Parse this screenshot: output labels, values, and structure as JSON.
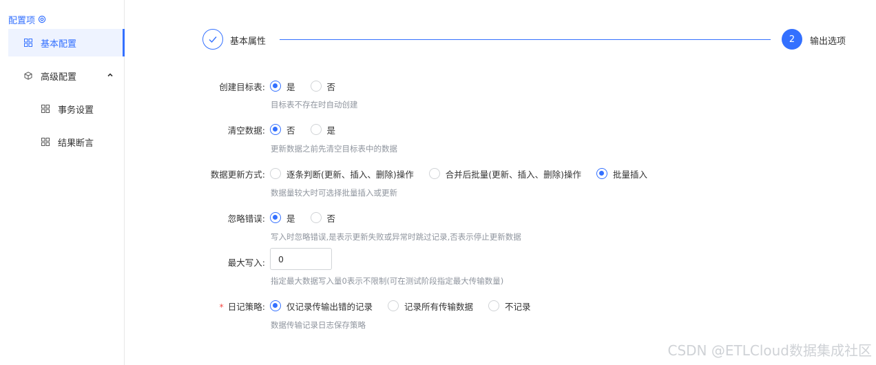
{
  "sidebar": {
    "title": "配置项",
    "items": [
      {
        "label": "基本配置"
      },
      {
        "label": "高级配置"
      },
      {
        "label": "事务设置"
      },
      {
        "label": "结果断言"
      }
    ]
  },
  "steps": [
    {
      "label": "基本属性",
      "state": "done"
    },
    {
      "number": "2",
      "label": "输出选项",
      "state": "current"
    }
  ],
  "form": {
    "create_table": {
      "label": "创建目标表:",
      "options": [
        "是",
        "否"
      ],
      "selected": "是",
      "hint": "目标表不存在时自动创建"
    },
    "clear_data": {
      "label": "清空数据:",
      "options": [
        "否",
        "是"
      ],
      "selected": "否",
      "hint": "更新数据之前先清空目标表中的数据"
    },
    "update_mode": {
      "label": "数据更新方式:",
      "options": [
        "逐条判断(更新、插入、删除)操作",
        "合并后批量(更新、插入、删除)操作",
        "批量插入"
      ],
      "selected": "批量插入",
      "hint": "数据量较大时可选择批量插入或更新"
    },
    "ignore_errors": {
      "label": "忽略错误:",
      "options": [
        "是",
        "否"
      ],
      "selected": "是",
      "hint": "写入时忽略错误,是表示更新失败或异常时跳过记录,否表示停止更新数据"
    },
    "max_write": {
      "label": "最大写入:",
      "value": "0",
      "hint": "指定最大数据写入量0表示不限制(可在测试阶段指定最大传输数量)"
    },
    "log_policy": {
      "label": "日记策略:",
      "required_mark": "*",
      "options": [
        "仅记录传输出错的记录",
        "记录所有传输数据",
        "不记录"
      ],
      "selected": "仅记录传输出错的记录",
      "hint": "数据传输记录日志保存策略"
    }
  },
  "watermark": "CSDN @ETLCloud数据集成社区",
  "colors": {
    "accent": "#3370ff",
    "active_bg": "#eef3ff",
    "hint": "#8f959e",
    "required": "#f54a45"
  }
}
